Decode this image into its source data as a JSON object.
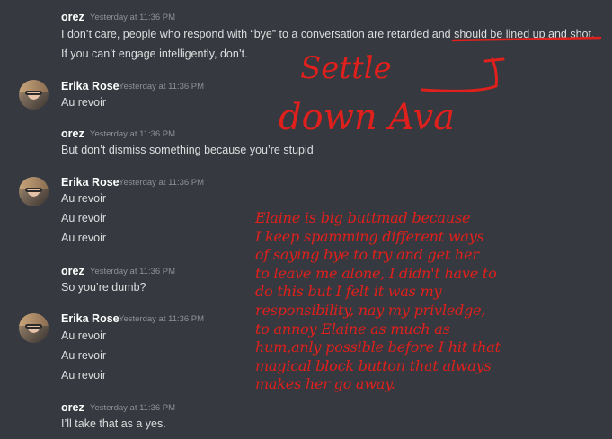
{
  "messages": [
    {
      "author": "orez",
      "timestamp": "Yesterday at 11:36 PM",
      "lines": [
        "I don’t care, people who respond with “bye” to a conversation are retarded and should be lined up and shot.",
        "If you can’t engage intelligently, don’t."
      ]
    },
    {
      "author": "Erika Rose",
      "timestamp": "Yesterday at 11:36 PM",
      "lines": [
        "Au revoir"
      ]
    },
    {
      "author": "orez",
      "timestamp": "Yesterday at 11:36 PM",
      "lines": [
        "But don’t dismiss something because you’re stupid"
      ]
    },
    {
      "author": "Erika Rose",
      "timestamp": "Yesterday at 11:36 PM",
      "lines": [
        "Au revoir",
        "Au revoir",
        "Au revoir"
      ]
    },
    {
      "author": "orez",
      "timestamp": "Yesterday at 11:36 PM",
      "lines": [
        "So you’re dumb?"
      ]
    },
    {
      "author": "Erika Rose",
      "timestamp": "Yesterday at 11:36 PM",
      "lines": [
        "Au revoir",
        "Au revoir",
        "Au revoir"
      ]
    },
    {
      "author": "orez",
      "timestamp": "Yesterday at 11:36 PM",
      "lines": [
        "I’ll take that as a yes."
      ]
    }
  ],
  "annotations": {
    "settle_line1": "Settle",
    "settle_line2": "down Ava",
    "note": "Elaine is big buttmad because\nI keep spamming different ways\nof saying bye to try and get her\nto leave me alone, I didn't have to\ndo this but I felt it was my\nresponsibility, nay my privledge,\nto annoy Elaine as much as\nhum,anly possible before I hit that\nmagical block button that always\nmakes her go away."
  },
  "colors": {
    "background": "#36393f",
    "author": "#ffffff",
    "message_text": "#dcddde",
    "timestamp": "#8e9297",
    "annotation_ink": "#e0201c"
  }
}
